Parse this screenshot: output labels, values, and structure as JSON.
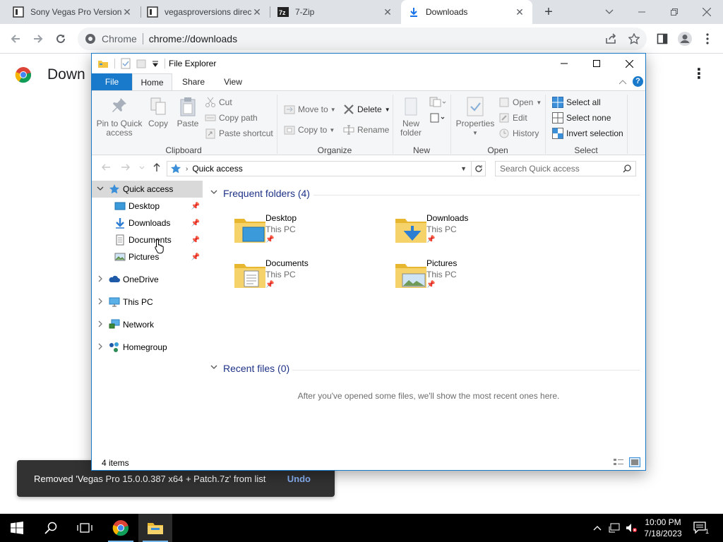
{
  "browser": {
    "tabs": [
      {
        "title": "Sony Vegas Pro Version"
      },
      {
        "title": "vegasproversions direc"
      },
      {
        "title": "7-Zip"
      },
      {
        "title": "Downloads"
      }
    ],
    "omnibox": {
      "chip": "Chrome",
      "url": "chrome://downloads"
    }
  },
  "downloads_page": {
    "title": "Down"
  },
  "snackbar": {
    "message": "Removed 'Vegas Pro 15.0.0.387 x64 + Patch.7z' from list",
    "action": "Undo"
  },
  "explorer": {
    "title": "File Explorer",
    "ribbon_tabs": [
      "File",
      "Home",
      "Share",
      "View"
    ],
    "ribbon": {
      "clipboard": {
        "label": "Clipboard",
        "pin": "Pin to Quick\naccess",
        "pin1": "Pin to Quick",
        "pin2": "access",
        "copy": "Copy",
        "paste": "Paste",
        "cut": "Cut",
        "copy_path": "Copy path",
        "paste_shortcut": "Paste shortcut"
      },
      "organize": {
        "label": "Organize",
        "move_to": "Move to",
        "copy_to": "Copy to",
        "delete": "Delete",
        "rename": "Rename"
      },
      "new": {
        "label": "New",
        "new_folder1": "New",
        "new_folder2": "folder"
      },
      "open": {
        "label": "Open",
        "properties": "Properties",
        "open": "Open",
        "edit": "Edit",
        "history": "History"
      },
      "select": {
        "label": "Select",
        "select_all": "Select all",
        "select_none": "Select none",
        "invert": "Invert selection"
      }
    },
    "address": {
      "crumb": "Quick access",
      "search_placeholder": "Search Quick access"
    },
    "nav": {
      "quick_access": "Quick access",
      "desktop": "Desktop",
      "downloads": "Downloads",
      "documents": "Documents",
      "pictures": "Pictures",
      "onedrive": "OneDrive",
      "this_pc": "This PC",
      "network": "Network",
      "homegroup": "Homegroup"
    },
    "frequent": {
      "header": "Frequent folders (4)",
      "folders": [
        {
          "name": "Desktop",
          "location": "This PC"
        },
        {
          "name": "Downloads",
          "location": "This PC"
        },
        {
          "name": "Documents",
          "location": "This PC"
        },
        {
          "name": "Pictures",
          "location": "This PC"
        }
      ]
    },
    "recent": {
      "header": "Recent files (0)",
      "empty_message": "After you've opened some files, we'll show the most recent ones here."
    },
    "status": {
      "count": "4 items"
    }
  },
  "taskbar": {
    "time": "10:00 PM",
    "date": "7/18/2023",
    "notification_count": "1"
  },
  "colors": {
    "accent": "#1979ca",
    "folder": "#f5c542",
    "taskbar": "#000000"
  }
}
